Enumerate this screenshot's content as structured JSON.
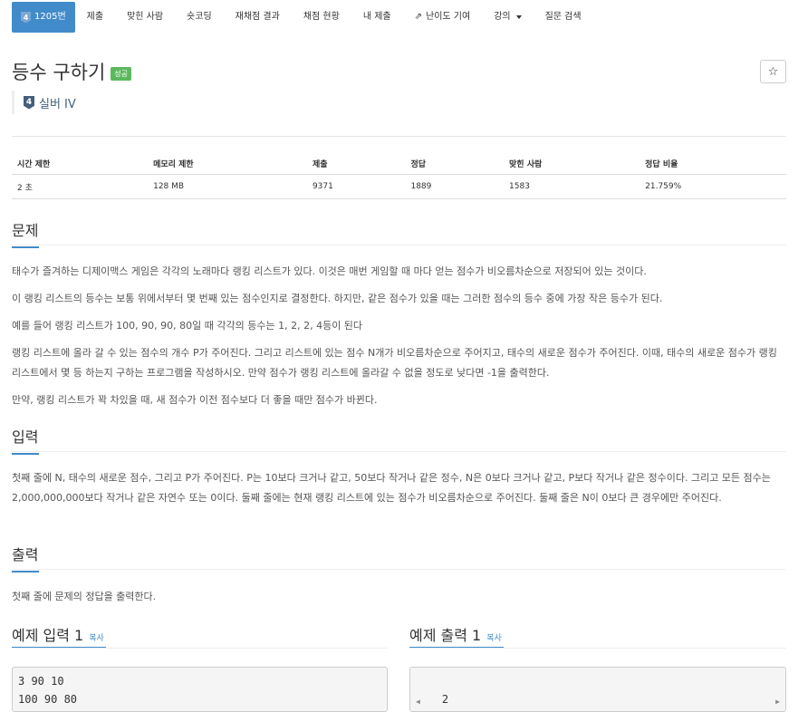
{
  "nav": {
    "tabs": [
      {
        "label": "1205번",
        "tier": "4",
        "active": true
      },
      {
        "label": "제출"
      },
      {
        "label": "맞힌 사람"
      },
      {
        "label": "숏코딩"
      },
      {
        "label": "재채점 결과"
      },
      {
        "label": "채점 현황"
      },
      {
        "label": "내 제출"
      },
      {
        "label": "난이도 기여"
      },
      {
        "label": "강의"
      },
      {
        "label": "질문 검색"
      }
    ]
  },
  "problem": {
    "title": "등수 구하기",
    "status": "성공",
    "tier_number": "4",
    "tier_label": "실버 IV",
    "star": "☆"
  },
  "stats": {
    "headers": [
      "시간 제한",
      "메모리 제한",
      "제출",
      "정답",
      "맞힌 사람",
      "정답 비율"
    ],
    "values": [
      "2 초",
      "128 MB",
      "9371",
      "1889",
      "1583",
      "21.759%"
    ]
  },
  "sections": {
    "problem_heading": "문제",
    "problem_paragraphs": [
      "태수가 즐겨하는 디제이맥스 게임은 각각의 노래마다 랭킹 리스트가 있다. 이것은 매번 게임할 때 마다 얻는 점수가 비오름차순으로 저장되어 있는 것이다.",
      "이 랭킹 리스트의 등수는 보통 위에서부터 몇 번째 있는 점수인지로 결정한다. 하지만, 같은 점수가 있을 때는 그러한 점수의 등수 중에 가장 작은 등수가 된다.",
      "예를 들어 랭킹 리스트가 100, 90, 90, 80일 때 각각의 등수는 1, 2, 2, 4등이 된다",
      "랭킹 리스트에 올라 갈 수 있는 점수의 개수 P가 주어진다. 그리고 리스트에 있는 점수 N개가 비오름차순으로 주어지고, 태수의 새로운 점수가 주어진다. 이때, 태수의 새로운 점수가 랭킹 리스트에서 몇 등 하는지 구하는 프로그램을 작성하시오. 만약 점수가 랭킹 리스트에 올라갈 수 없을 정도로 낮다면 -1을 출력한다.",
      "만약, 랭킹 리스트가 꽉 차있을 때, 새 점수가 이전 점수보다 더 좋을 때만 점수가 바뀐다."
    ],
    "input_heading": "입력",
    "input_text": "첫째 줄에 N, 태수의 새로운 점수, 그리고 P가 주어진다. P는 10보다 크거나 같고, 50보다 작거나 같은 정수, N은 0보다 크거나 같고, P보다 작거나 같은 정수이다. 그리고 모든 점수는 2,000,000,000보다 작거나 같은 자연수 또는 0이다. 둘째 줄에는 현재 랭킹 리스트에 있는 점수가 비오름차순으로 주어진다. 둘째 줄은 N이 0보다 큰 경우에만 주어진다.",
    "output_heading": "출력",
    "output_text": "첫째 줄에 문제의 정답을 출력한다."
  },
  "samples": {
    "input_title": "예제 입력 1",
    "output_title": "예제 출력 1",
    "copy_label": "복사",
    "input_text": "3 90 10\n100 90 80",
    "output_text": "2"
  }
}
